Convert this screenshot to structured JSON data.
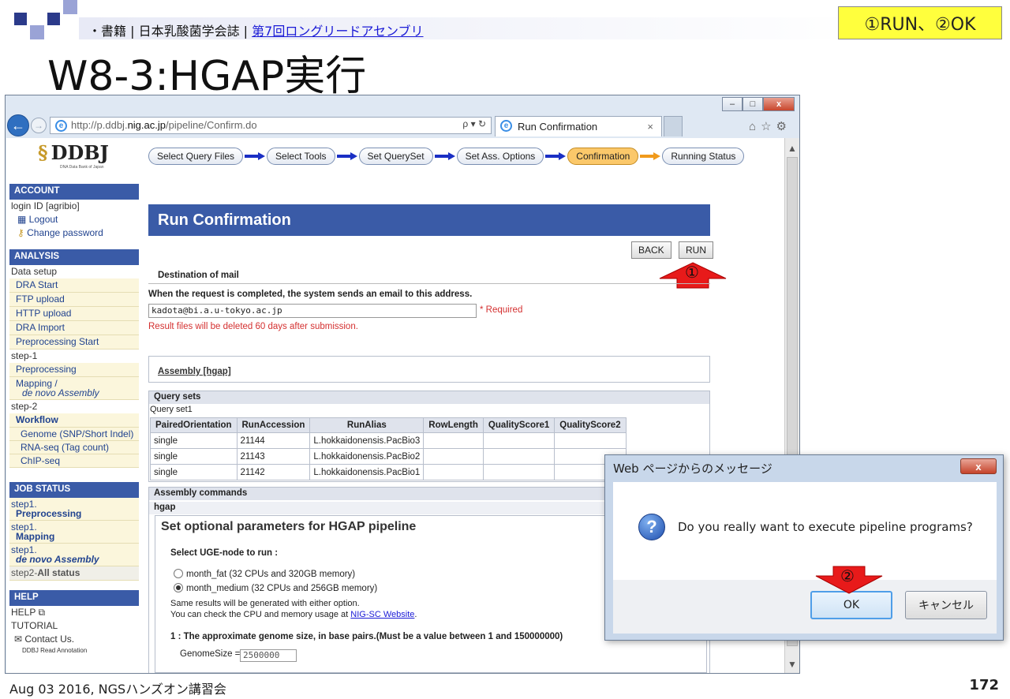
{
  "slide": {
    "bullet_prefix": "・書籍 | 日本乳酸菌学会誌 | ",
    "bullet_link": "第7回ロングリードアセンブリ",
    "callout": "①RUN、②OK",
    "title": "W8-3:HGAP実行",
    "footer": "Aug 03 2016, NGSハンズオン講習会",
    "page_number": "172"
  },
  "browser": {
    "url_prefix": "http://p.ddbj.",
    "url_host": "nig.ac.jp",
    "url_path": "/pipeline/Confirm.do",
    "url_tools": "ρ ▾ ↻",
    "tab_title": "Run Confirmation",
    "tab_close": "×",
    "toolbar_icons": "⌂☆⚙",
    "window_controls": [
      "–",
      "□",
      "x"
    ]
  },
  "logo": {
    "text": "DDBJ",
    "glyph": "§",
    "subtitle": "DNA Data Bank of Japan"
  },
  "sidebar": {
    "account_header": "ACCOUNT",
    "login_id": "login ID [agribio]",
    "logout": "Logout",
    "change_password": "Change password",
    "analysis_header": "ANALYSIS",
    "data_setup": "Data setup",
    "data_setup_items": [
      "DRA Start",
      "FTP upload",
      "HTTP upload",
      "DRA Import",
      "Preprocessing Start"
    ],
    "step1": "step-1",
    "step1_items": [
      "Preprocessing"
    ],
    "mapping_label": "Mapping /",
    "denovo_label": "de novo Assembly",
    "step2": "step-2",
    "workflow": "Workflow",
    "workflow_items": [
      "Genome (SNP/Short Indel)",
      "RNA-seq (Tag count)",
      "ChIP-seq"
    ],
    "job_status_header": "JOB STATUS",
    "job_step_label": "step1.",
    "job_preprocessing": "Preprocessing",
    "job_mapping": "Mapping",
    "job_denovo": "de novo Assembly",
    "job_step2_prefix": "step2-",
    "job_step2_all": "All status",
    "help_header": "HELP",
    "help_link": "HELP",
    "tutorial": "TUTORIAL",
    "contact": "Contact Us.",
    "ddbj_read_annotation": "DDBJ Read Annotation"
  },
  "steps": [
    "Select Query Files",
    "Select Tools",
    "Set QuerySet",
    "Set Ass. Options",
    "Confirmation",
    "Running Status"
  ],
  "main": {
    "banner": "Run Confirmation",
    "back_button": "BACK",
    "run_button": "RUN",
    "marker_1": "①",
    "destination_label": "Destination of mail",
    "email_note": "When the request is completed, the system sends an email to this address.",
    "email_value": "kadota@bi.a.u-tokyo.ac.jp",
    "required_note": "* Required",
    "deletion_note": "Result files will be deleted 60 days after submission.",
    "assembly_link": "Assembly [hgap]",
    "query_sets_header": "Query sets",
    "query_set_name": "Query set1",
    "table": {
      "headers": [
        "PairedOrientation",
        "RunAccession",
        "RunAlias",
        "RowLength",
        "QualityScore1",
        "QualityScore2"
      ],
      "rows": [
        [
          "single",
          "21144",
          "L.hokkaidonensis.PacBio3",
          "",
          "",
          ""
        ],
        [
          "single",
          "21143",
          "L.hokkaidonensis.PacBio2",
          "",
          "",
          ""
        ],
        [
          "single",
          "21142",
          "L.hokkaidonensis.PacBio1",
          "",
          "",
          ""
        ]
      ]
    },
    "assembly_commands_header": "Assembly commands",
    "hgap_label": "hgap",
    "hgap_title": "Set optional parameters for HGAP pipeline",
    "uge_label": "Select UGE-node to run :",
    "option_fat": "month_fat (32 CPUs and 320GB memory)",
    "option_medium": "month_medium (32 CPUs and 256GB memory)",
    "same_results": "Same results will be generated with either option.",
    "cpu_check_prefix": "You can check the CPU and memory usage at ",
    "cpu_check_link": "NIG-SC Website",
    "cpu_check_suffix": ".",
    "genome_size_label": "1 : The approximate genome size, in base pairs.(Must be a value between 1 and 150000000)",
    "genome_size_field": "GenomeSize =",
    "genome_size_value": "2500000"
  },
  "dialog": {
    "title": "Web ページからのメッセージ",
    "close": "x",
    "message": "Do you really want to execute pipeline programs?",
    "ok": "OK",
    "cancel": "キャンセル",
    "marker_2": "②"
  }
}
